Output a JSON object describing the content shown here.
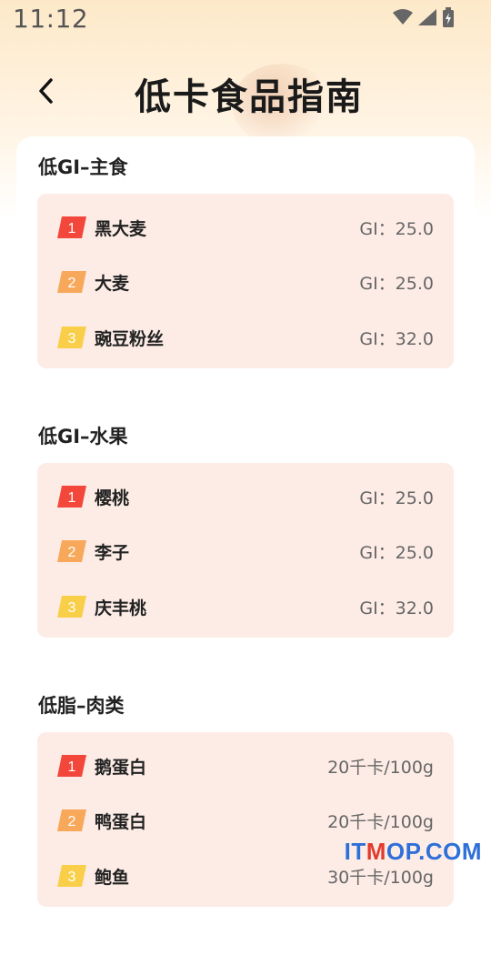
{
  "status": {
    "time": "11:12"
  },
  "header": {
    "title": "低卡食品指南"
  },
  "sections": [
    {
      "title": "低GI–主食",
      "items": [
        {
          "rank": "1",
          "name": "黑大麦",
          "value": "GI：25.0"
        },
        {
          "rank": "2",
          "name": "大麦",
          "value": "GI：25.0"
        },
        {
          "rank": "3",
          "name": "豌豆粉丝",
          "value": "GI：32.0"
        }
      ]
    },
    {
      "title": "低GI–水果",
      "items": [
        {
          "rank": "1",
          "name": "樱桃",
          "value": "GI：25.0"
        },
        {
          "rank": "2",
          "name": "李子",
          "value": "GI：25.0"
        },
        {
          "rank": "3",
          "name": "庆丰桃",
          "value": "GI：32.0"
        }
      ]
    },
    {
      "title": "低脂–肉类",
      "items": [
        {
          "rank": "1",
          "name": "鹅蛋白",
          "value": "20千卡/100g"
        },
        {
          "rank": "2",
          "name": "鸭蛋白",
          "value": "20千卡/100g"
        },
        {
          "rank": "3",
          "name": "鲍鱼",
          "value": "30千卡/100g"
        }
      ]
    }
  ],
  "badge_colors": {
    "1": "#f2473a",
    "2": "#f7a85a",
    "3": "#f9cf4a"
  },
  "watermark": {
    "left": "IT",
    "middle": "M",
    "right": "OP.COM"
  }
}
